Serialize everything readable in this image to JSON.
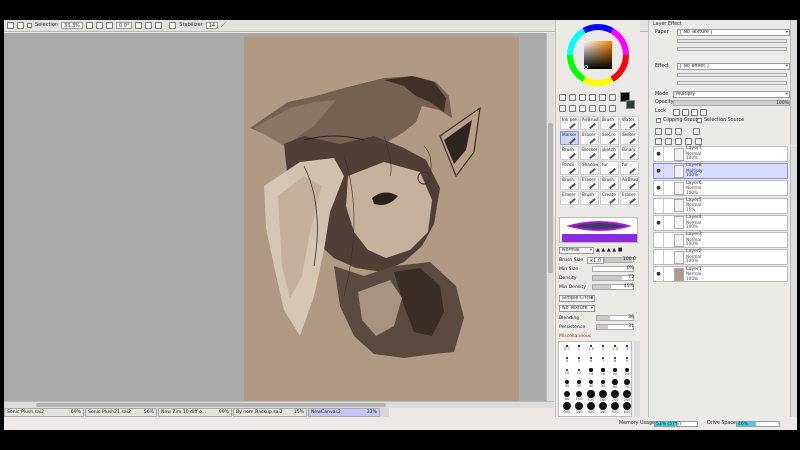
{
  "toolbar": {
    "selection_label": "Selection",
    "zoom": "33.3%",
    "angle": "0.0°",
    "stabilizer_label": "Stabilizer",
    "stabilizer_value": "14"
  },
  "doc_tabs": [
    {
      "name": "Sonic Plush.sai2",
      "zoom": "69%"
    },
    {
      "name": "Sonic Plush21.sai2",
      "zoom": "56%"
    },
    {
      "name": "New Zim 10 diff o...",
      "zoom": "99%"
    },
    {
      "name": "By nom Backup.sai2",
      "zoom": "15%"
    },
    {
      "name": "NewCanvas2",
      "zoom": "33%"
    }
  ],
  "status": {
    "memory_label": "Memory Usage",
    "memory_value": "53% (57%)",
    "memory_fraction": 0.53,
    "drive_label": "Drive Space",
    "drive_value": "46%",
    "drive_fraction": 0.46
  },
  "tools": [
    {
      "label": "Ink pen"
    },
    {
      "label": "AirBrush"
    },
    {
      "label": "Brush"
    },
    {
      "label": "Water"
    },
    {
      "label": "Marker"
    },
    {
      "label": "Eraser"
    },
    {
      "label": "SelCre"
    },
    {
      "label": "SelRer"
    },
    {
      "label": "Brush"
    },
    {
      "label": "Blocker"
    },
    {
      "label": "sketch"
    },
    {
      "label": "Binary"
    },
    {
      "label": "Pencil"
    },
    {
      "label": "Shadow"
    },
    {
      "label": "fur"
    },
    {
      "label": "fur"
    },
    {
      "label": "Brush"
    },
    {
      "label": "Eraser"
    },
    {
      "label": "Brush"
    },
    {
      "label": "AirBrush"
    },
    {
      "label": "Eraser"
    },
    {
      "label": "Brush"
    },
    {
      "label": "Create"
    },
    {
      "label": "Eraser"
    }
  ],
  "brush": {
    "blend_mode": "Normal",
    "size_label": "Brush Size",
    "size_mult": "x1.0",
    "size_value": "100.0",
    "min_size_label": "Min Size",
    "min_size_value": "0%",
    "density_label": "Density",
    "density_value": "72",
    "min_density_label": "Min Density",
    "min_density_value": "45%",
    "shape": "Simple Circle",
    "texture": "No Texture",
    "blending_label": "Blending",
    "blending_value": "36",
    "persistence_label": "Persistence",
    "persistence_value": "31",
    "misc_label": "Miscellaneous"
  },
  "brush_sizes": [
    "0.7",
    "1",
    "1.5",
    "2",
    "2.3",
    "3",
    "4",
    "5",
    "6",
    "7",
    "8",
    "9",
    "10",
    "12",
    "14",
    "16",
    "20",
    "25",
    "30",
    "35",
    "40",
    "50",
    "60",
    "70",
    "80",
    "100",
    "120",
    "160",
    "200",
    "250",
    "300",
    "350",
    "400",
    "450",
    "500",
    "600"
  ],
  "layer_panel": {
    "title": "Layer Effect",
    "paper_label": "Paper",
    "paper_value": "[ No Texture ]",
    "effect_label": "Effect",
    "effect_value": "[ No effect ]",
    "mode_label": "Mode",
    "mode_value": "Multiply",
    "opacity_label": "Opacity",
    "opacity_value": "100%",
    "lock_label": "Lock",
    "clipping_label": "Clipping Group",
    "selection_source_label": "Selection Source"
  },
  "layers": [
    {
      "name": "Layer7",
      "mode": "Normal",
      "opacity": "100%",
      "visible": true,
      "active": false
    },
    {
      "name": "Layer8",
      "mode": "Multiply",
      "opacity": "100%",
      "visible": true,
      "active": true
    },
    {
      "name": "Layer6",
      "mode": "Normal",
      "opacity": "100%",
      "visible": true,
      "active": false
    },
    {
      "name": "Layer5",
      "mode": "Normal",
      "opacity": "15%",
      "visible": false,
      "active": false
    },
    {
      "name": "Layer4",
      "mode": "Normal",
      "opacity": "100%",
      "visible": true,
      "active": false
    },
    {
      "name": "Layer3",
      "mode": "Normal",
      "opacity": "100%",
      "visible": false,
      "active": false
    },
    {
      "name": "Layer2",
      "mode": "Normal",
      "opacity": "100%",
      "visible": false,
      "active": false
    },
    {
      "name": "Layer1",
      "mode": "Normal",
      "opacity": "100%",
      "visible": true,
      "active": false
    }
  ],
  "colors": {
    "paper": "#b09a84",
    "primary": "#000000",
    "secondary": "#ffffff",
    "accent": "#3ccfe0",
    "active_layer": "#d9dcfb"
  }
}
